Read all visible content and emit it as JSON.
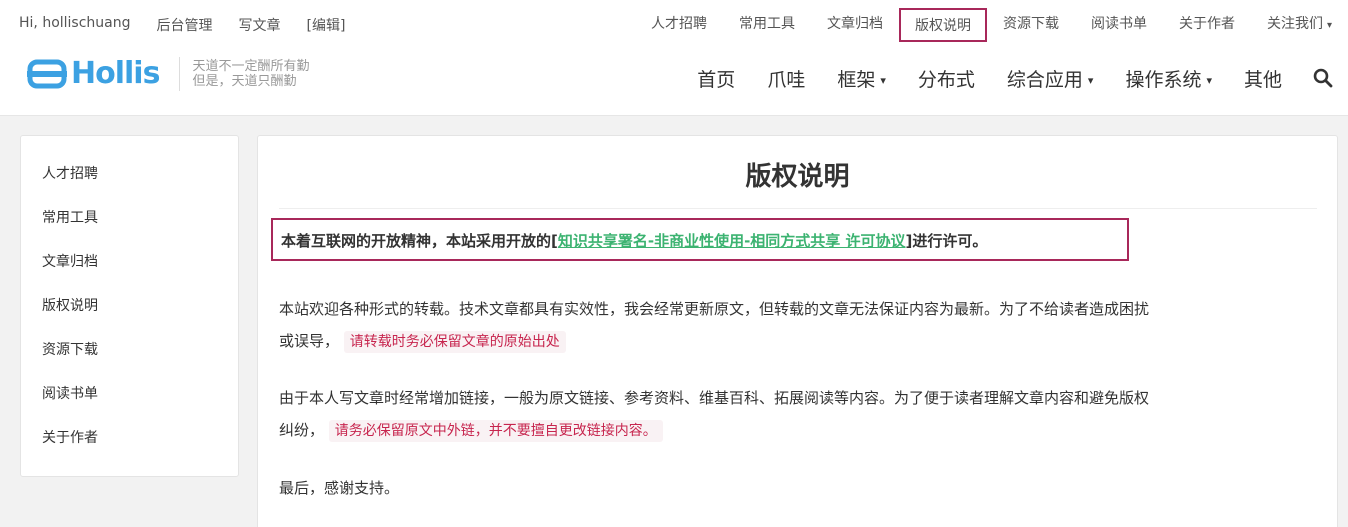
{
  "topbar": {
    "greeting": "Hi, hollischuang",
    "admin": "后台管理",
    "write": "写文章",
    "edit": "[编辑]",
    "nav": [
      {
        "label": "人才招聘"
      },
      {
        "label": "常用工具"
      },
      {
        "label": "文章归档"
      },
      {
        "label": "版权说明"
      },
      {
        "label": "资源下载"
      },
      {
        "label": "阅读书单"
      },
      {
        "label": "关于作者"
      },
      {
        "label": "关注我们"
      }
    ],
    "active_color": "#a8285a"
  },
  "header": {
    "logo_text": "Hollis",
    "slogan_line1": "天道不一定酬所有勤",
    "slogan_line2": "但是，天道只酬勤",
    "nav": [
      {
        "label": "首页"
      },
      {
        "label": "爪哇"
      },
      {
        "label": "框架"
      },
      {
        "label": "分布式"
      },
      {
        "label": "综合应用"
      },
      {
        "label": "操作系统"
      },
      {
        "label": "其他"
      }
    ],
    "search_icon": "search-icon",
    "logo_color": "#3ca1e2"
  },
  "sidebar": {
    "items": [
      {
        "label": "人才招聘"
      },
      {
        "label": "常用工具"
      },
      {
        "label": "文章归档"
      },
      {
        "label": "版权说明"
      },
      {
        "label": "资源下载"
      },
      {
        "label": "阅读书单"
      },
      {
        "label": "关于作者"
      }
    ]
  },
  "content": {
    "title": "版权说明",
    "license_prefix": "本着互联网的开放精神，本站采用开放的[",
    "license_link": "知识共享署名-非商业性使用-相同方式共享 许可协议",
    "license_suffix": "]进行许可。",
    "p1_line1": "本站欢迎各种形式的转载。技术文章都具有实效性，我会经常更新原文，但转载的文章无法保证内容为最新。为了不给读者造成困扰",
    "p1_line2": "或误导，",
    "p1_highlight": "请转载时务必保留文章的原始出处",
    "p2_line1": "由于本人写文章时经常增加链接，一般为原文链接、参考资料、维基百科、拓展阅读等内容。为了便于读者理解文章内容和避免版权",
    "p2_line2": "纠纷，",
    "p2_highlight": "请务必保留原文中外链，并不要擅自更改链接内容。",
    "p3": "最后，感谢支持。",
    "link_color": "#3cb371",
    "highlight_color": "#c7254e"
  }
}
